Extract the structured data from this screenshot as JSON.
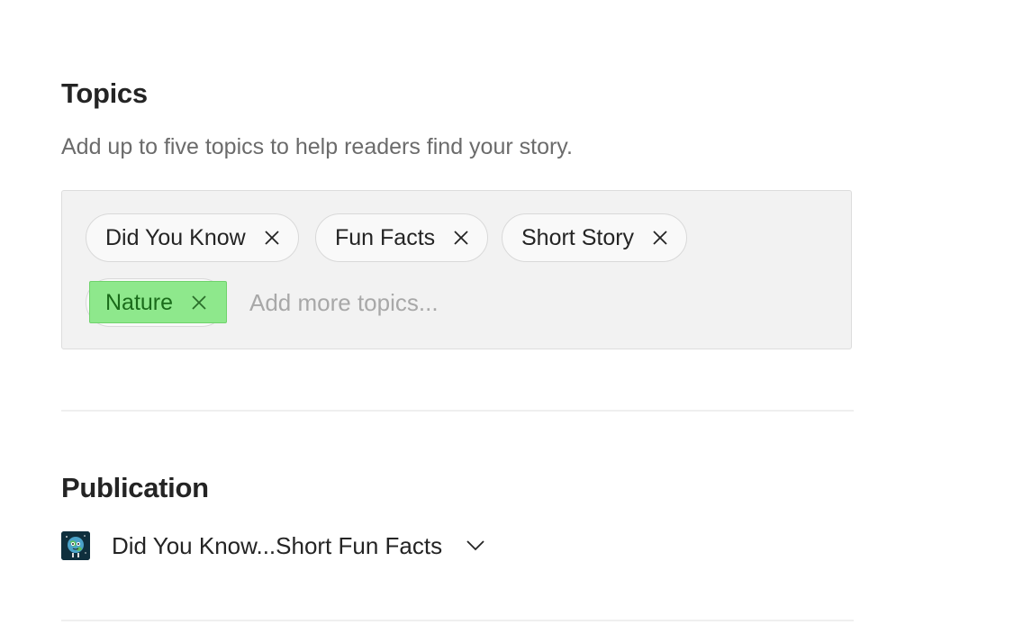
{
  "topics": {
    "title": "Topics",
    "description": "Add up to five topics to help readers find your story.",
    "chips": [
      {
        "label": "Did You Know"
      },
      {
        "label": "Fun Facts"
      },
      {
        "label": "Short Story"
      },
      {
        "label": "Nature",
        "highlighted": true
      }
    ],
    "input": {
      "value": "",
      "placeholder": "Add more topics..."
    }
  },
  "publication": {
    "title": "Publication",
    "selected": "Did You Know...Short Fun Facts",
    "avatar_icon": "globe-mascot-icon"
  },
  "colors": {
    "highlight": "#8ee88c",
    "box_background": "#f2f2f2",
    "text_primary": "#242424",
    "text_secondary": "#6b6b6b"
  }
}
